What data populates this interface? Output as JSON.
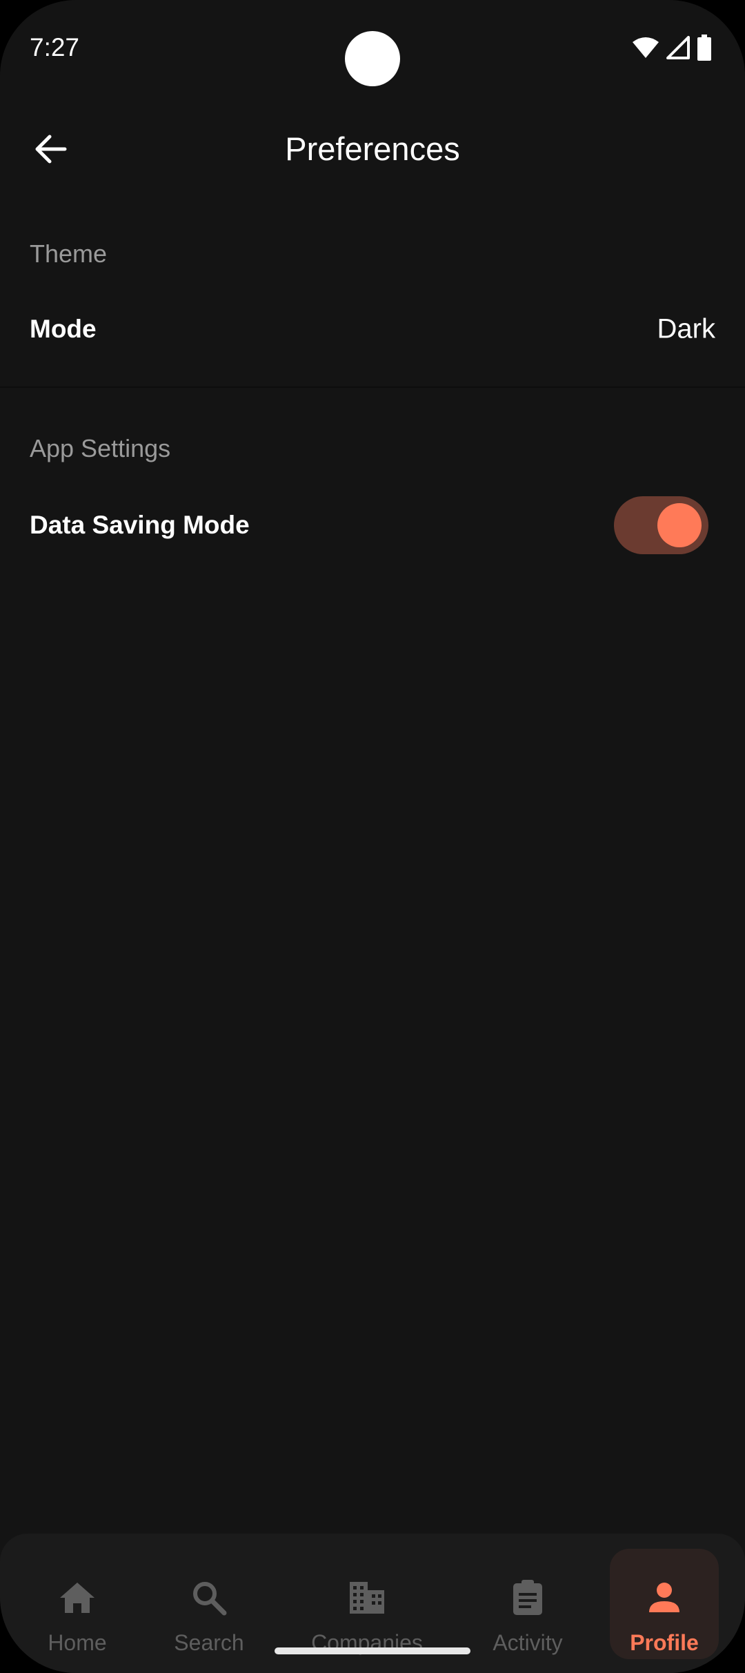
{
  "status_bar": {
    "time": "7:27",
    "icons": [
      "wifi-icon",
      "signal-icon",
      "battery-icon"
    ]
  },
  "app_bar": {
    "back_icon": "arrow-back-icon",
    "title": "Preferences"
  },
  "sections": {
    "theme": {
      "header": "Theme",
      "mode_label": "Mode",
      "mode_value": "Dark"
    },
    "app_settings": {
      "header": "App Settings",
      "data_saving_label": "Data Saving Mode",
      "data_saving_enabled": true
    }
  },
  "bottom_nav": {
    "items": [
      {
        "label": "Home",
        "icon": "home-icon",
        "active": false
      },
      {
        "label": "Search",
        "icon": "search-icon",
        "active": false
      },
      {
        "label": "Companies",
        "icon": "building-icon",
        "active": false
      },
      {
        "label": "Activity",
        "icon": "clipboard-icon",
        "active": false
      },
      {
        "label": "Profile",
        "icon": "person-icon",
        "active": true
      }
    ]
  },
  "colors": {
    "background": "#141414",
    "accent": "#ff7a58",
    "toggle_track": "#6b3b30",
    "inactive_nav": "#5e5e5e",
    "section_header": "#9a9a9a"
  }
}
